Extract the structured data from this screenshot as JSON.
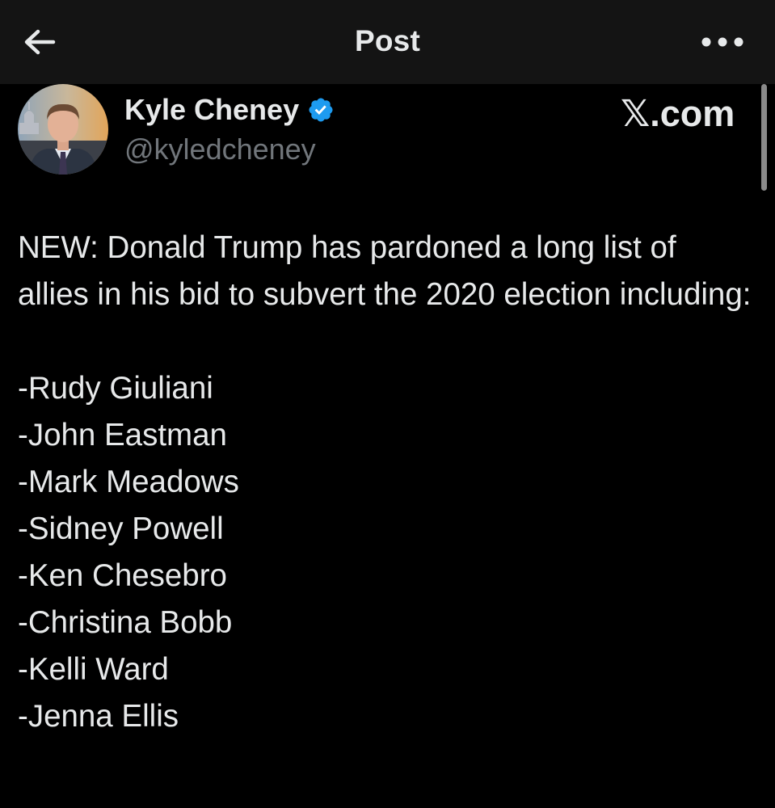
{
  "header": {
    "title": "Post",
    "back_icon": "arrow-left-icon",
    "more_icon": "more-horizontal-icon"
  },
  "author": {
    "name": "Kyle Cheney",
    "handle": "@kyledcheney",
    "verified": true,
    "verified_color": "#1d9bf0"
  },
  "watermark": {
    "text": "𝕏.com"
  },
  "post": {
    "intro": "NEW: Donald Trump has pardoned a long list of allies in his bid to subvert the 2020 election including:",
    "list": [
      "-Rudy Giuliani",
      "-John Eastman",
      "-Mark Meadows",
      "-Sidney Powell",
      "-Ken Chesebro",
      "-Christina Bobb",
      "-Kelli Ward",
      "-Jenna Ellis"
    ]
  },
  "colors": {
    "background": "#000000",
    "header_background": "#141414",
    "text_primary": "#e7e9ea",
    "text_secondary": "#71767b",
    "accent": "#1d9bf0"
  }
}
